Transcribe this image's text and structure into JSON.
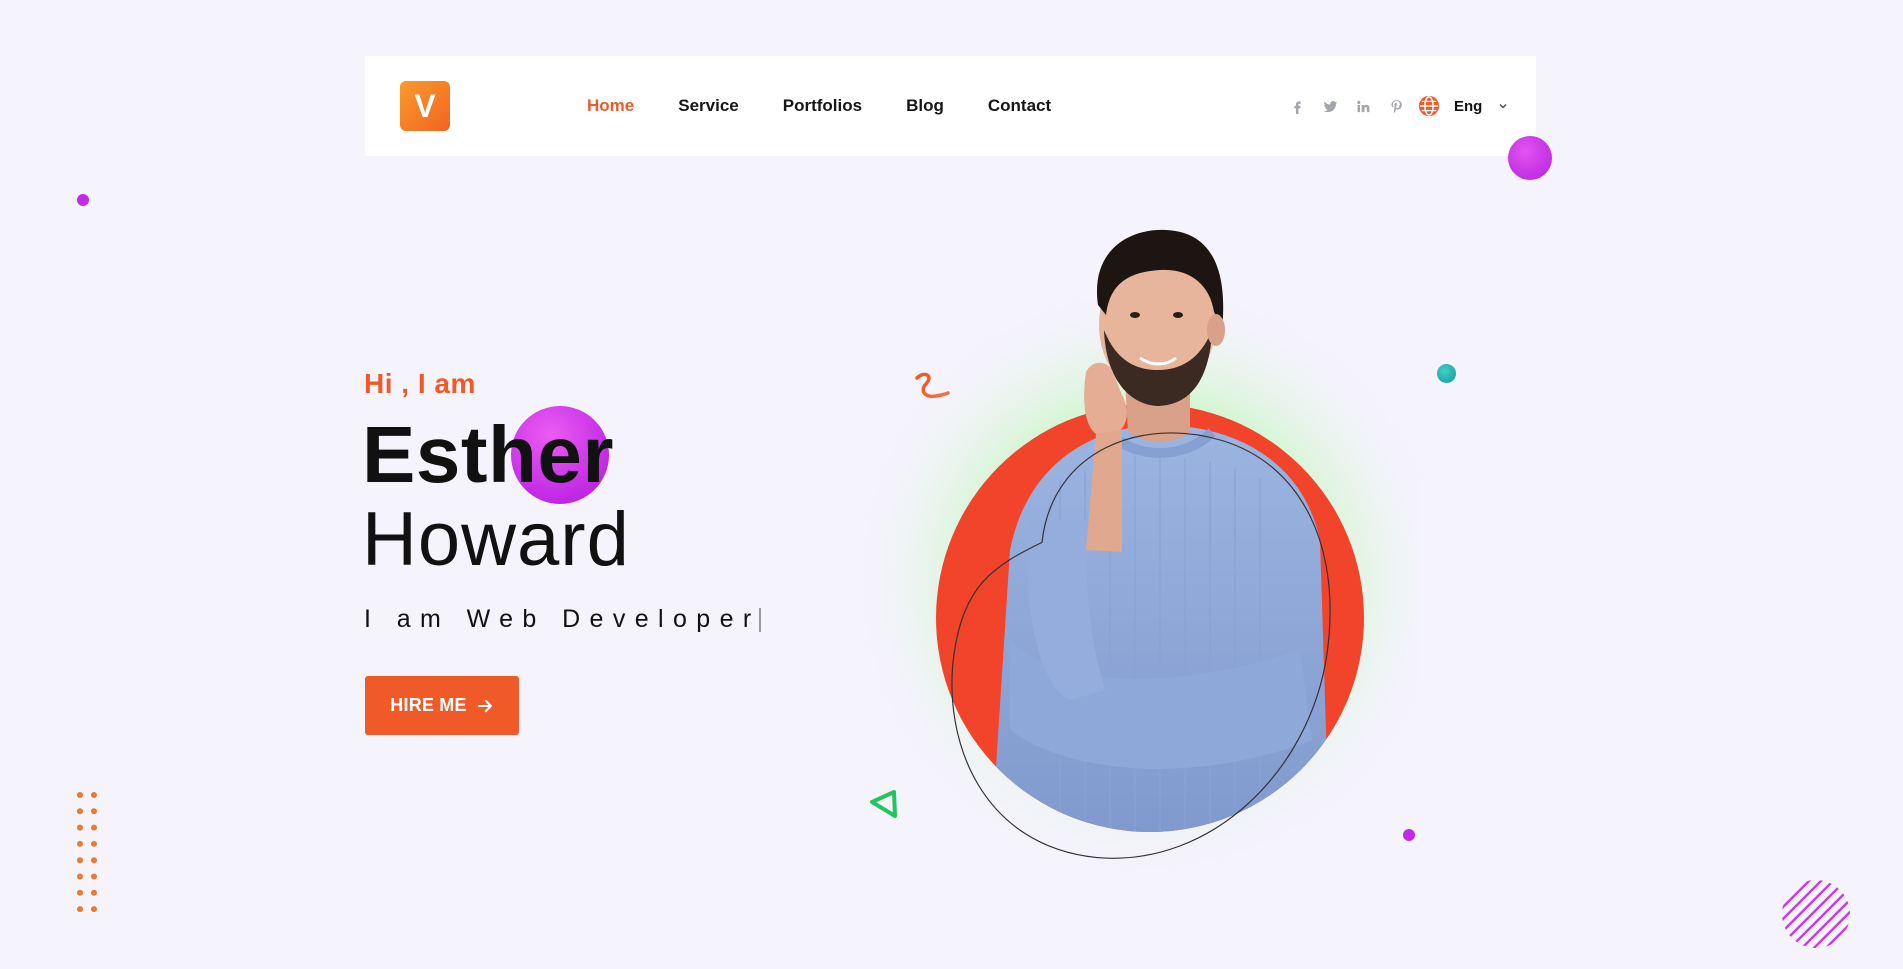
{
  "brand": {
    "logo_letter": "V"
  },
  "nav": {
    "items": [
      {
        "label": "Home",
        "active": true
      },
      {
        "label": "Service",
        "active": false
      },
      {
        "label": "Portfolios",
        "active": false
      },
      {
        "label": "Blog",
        "active": false
      },
      {
        "label": "Contact",
        "active": false
      }
    ]
  },
  "social": {
    "icons": [
      "facebook-icon",
      "twitter-icon",
      "linkedin-icon",
      "pinterest-icon"
    ]
  },
  "language": {
    "label": "Eng",
    "icon": "globe-icon"
  },
  "hero": {
    "greeting": "Hi , I am",
    "first_name": "Esther",
    "last_name": "Howard",
    "role": "I am Web Developer",
    "cta_label": "HIRE ME"
  },
  "colors": {
    "accent": "#f05a28",
    "purple": "#c22ae4",
    "green": "#22c55e",
    "teal": "#1fb5b0",
    "background": "#f5f3fc"
  }
}
